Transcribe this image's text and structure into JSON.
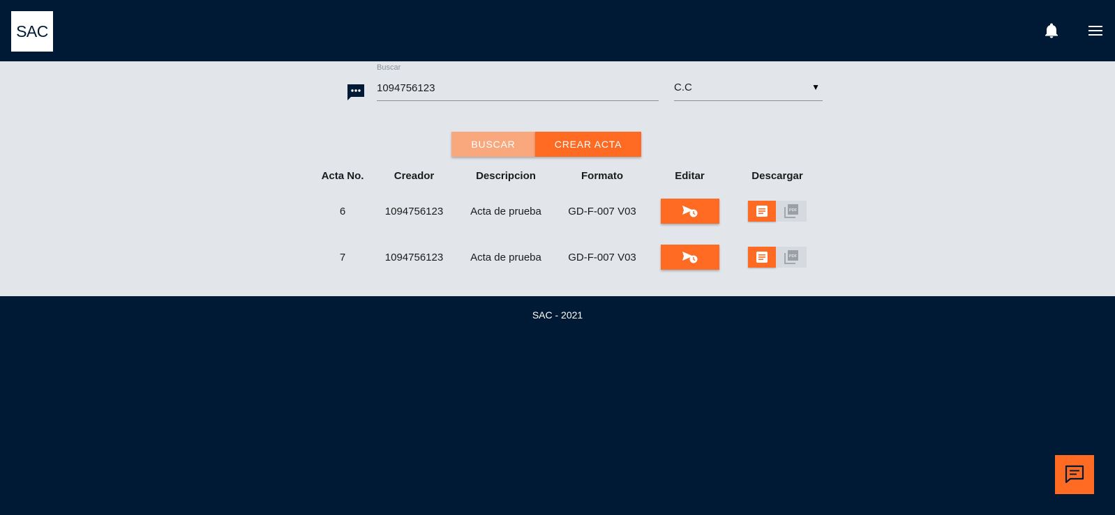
{
  "header": {
    "logo_text": "SAC",
    "icons": [
      "bell-icon",
      "menu-icon"
    ]
  },
  "search": {
    "label": "Buscar",
    "value": "1094756123",
    "doc_type": "C.C",
    "chat_icon": "chat-dots-icon"
  },
  "buttons": {
    "buscar_label": "BUSCAR",
    "crear_label": "CREAR ACTA"
  },
  "table": {
    "headers": [
      "Acta No.",
      "Creador",
      "Descripcion",
      "Formato",
      "Editar",
      "Descargar"
    ],
    "rows": [
      {
        "acta": "6",
        "creador": "1094756123",
        "descripcion": "Acta de prueba",
        "formato": "GD-F-007 V03"
      },
      {
        "acta": "7",
        "creador": "1094756123",
        "descripcion": "Acta de prueba",
        "formato": "GD-F-007 V03"
      }
    ],
    "row_icons": {
      "edit": "send-schedule-icon",
      "download_doc": "document-icon",
      "download_pdf": "pdf-icon"
    }
  },
  "footer": {
    "text": "SAC - 2021",
    "fab_icon": "feedback-chat-icon"
  },
  "colors": {
    "navy": "#001a35",
    "background": "#e2e6eb",
    "accent": "#ff6b22",
    "accent_light": "#f9a77c"
  }
}
